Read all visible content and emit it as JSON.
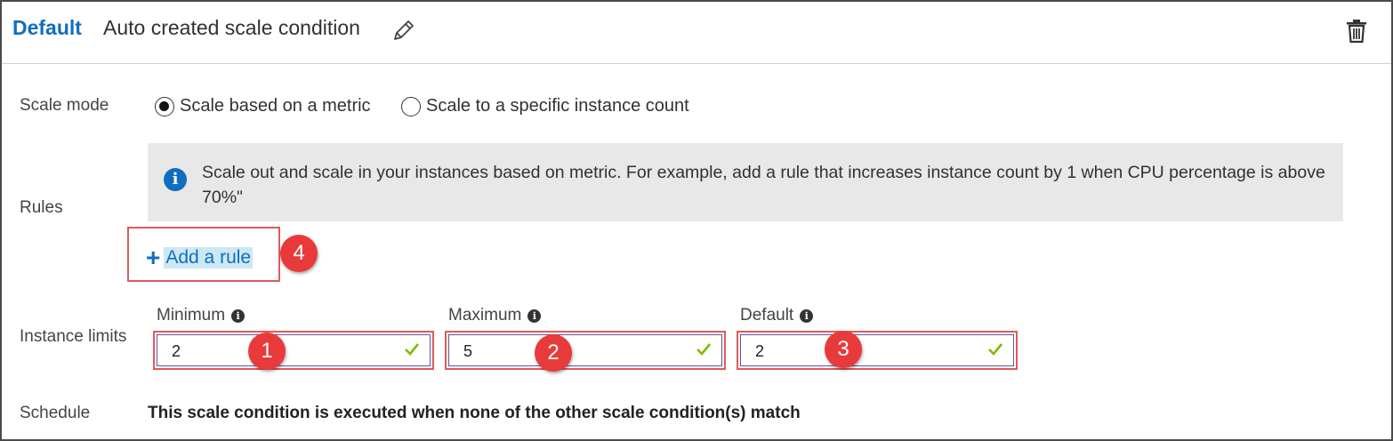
{
  "header": {
    "profile_name": "Default",
    "condition_title": "Auto created scale condition",
    "edit_icon": "pencil-icon",
    "delete_icon": "trash-icon"
  },
  "scale_mode": {
    "label": "Scale mode",
    "options": [
      {
        "label": "Scale based on a metric",
        "selected": true
      },
      {
        "label": "Scale to a specific instance count",
        "selected": false
      }
    ]
  },
  "rules": {
    "label": "Rules",
    "info_text": "Scale out and scale in your instances based on metric. For example, add a rule that increases instance count by 1 when CPU percentage is above 70%\"",
    "add_rule_label": "Add a rule"
  },
  "instance_limits": {
    "label": "Instance limits",
    "fields": [
      {
        "label": "Minimum",
        "value": "2"
      },
      {
        "label": "Maximum",
        "value": "5"
      },
      {
        "label": "Default",
        "value": "2"
      }
    ]
  },
  "schedule": {
    "label": "Schedule",
    "text": "This scale condition is executed when none of the other scale condition(s) match"
  },
  "callouts": [
    "4",
    "1",
    "2",
    "3"
  ],
  "colors": {
    "accent": "#106ebe",
    "callout": "#e83a3a",
    "valid_check": "#7fba00"
  }
}
